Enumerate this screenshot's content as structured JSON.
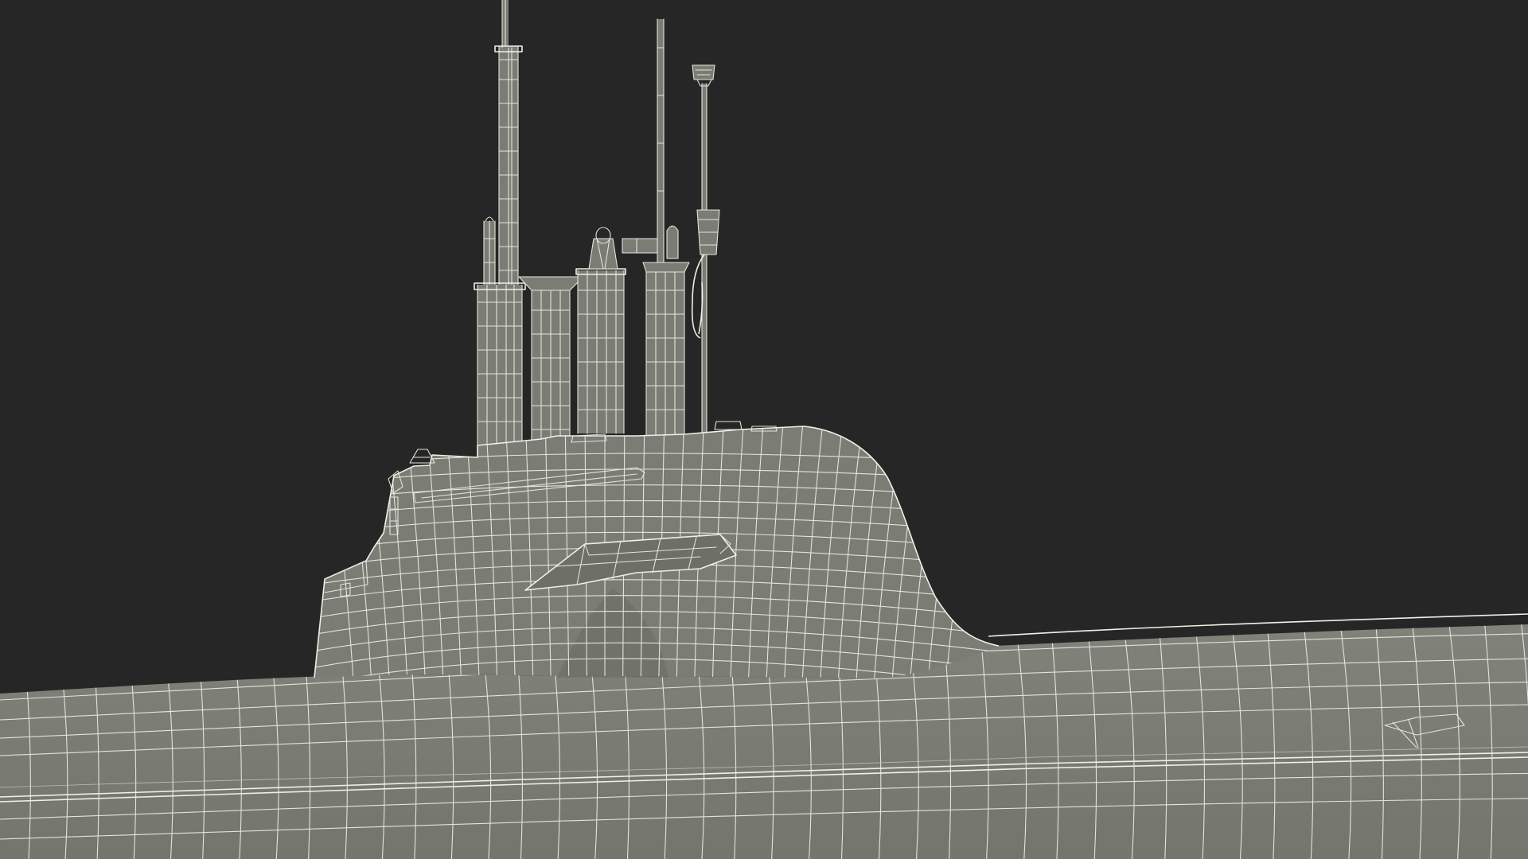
{
  "scene": {
    "background_color": "#262626",
    "model_color": "#7b7c73",
    "model_shadow_color": "#65665e",
    "wire_color": "#e4e3dc"
  }
}
